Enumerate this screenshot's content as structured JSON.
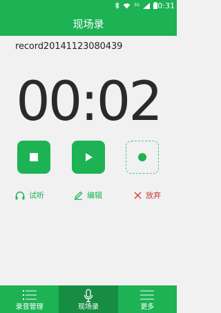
{
  "status_bar": {
    "time": "20:31",
    "network": "3G",
    "icons": [
      "bluetooth-icon",
      "wifi-icon",
      "signal-icon",
      "battery-icon"
    ]
  },
  "app_bar": {
    "title": "现场录"
  },
  "recording": {
    "file_name": "record20141123080439",
    "elapsed": "00:02"
  },
  "controls": {
    "stop": "stop-icon",
    "play": "play-icon",
    "record": "record-icon"
  },
  "actions": {
    "listen": "试听",
    "edit": "编辑",
    "discard": "放弃"
  },
  "bottom_nav": {
    "items": [
      {
        "label": "录音管理",
        "icon": "list-icon"
      },
      {
        "label": "现场录",
        "icon": "microphone-icon",
        "active": true
      },
      {
        "label": "更多",
        "icon": "menu-icon"
      }
    ]
  },
  "colors": {
    "accent": "#1db254",
    "accent_dark": "#178c43",
    "danger": "#c9392f"
  }
}
